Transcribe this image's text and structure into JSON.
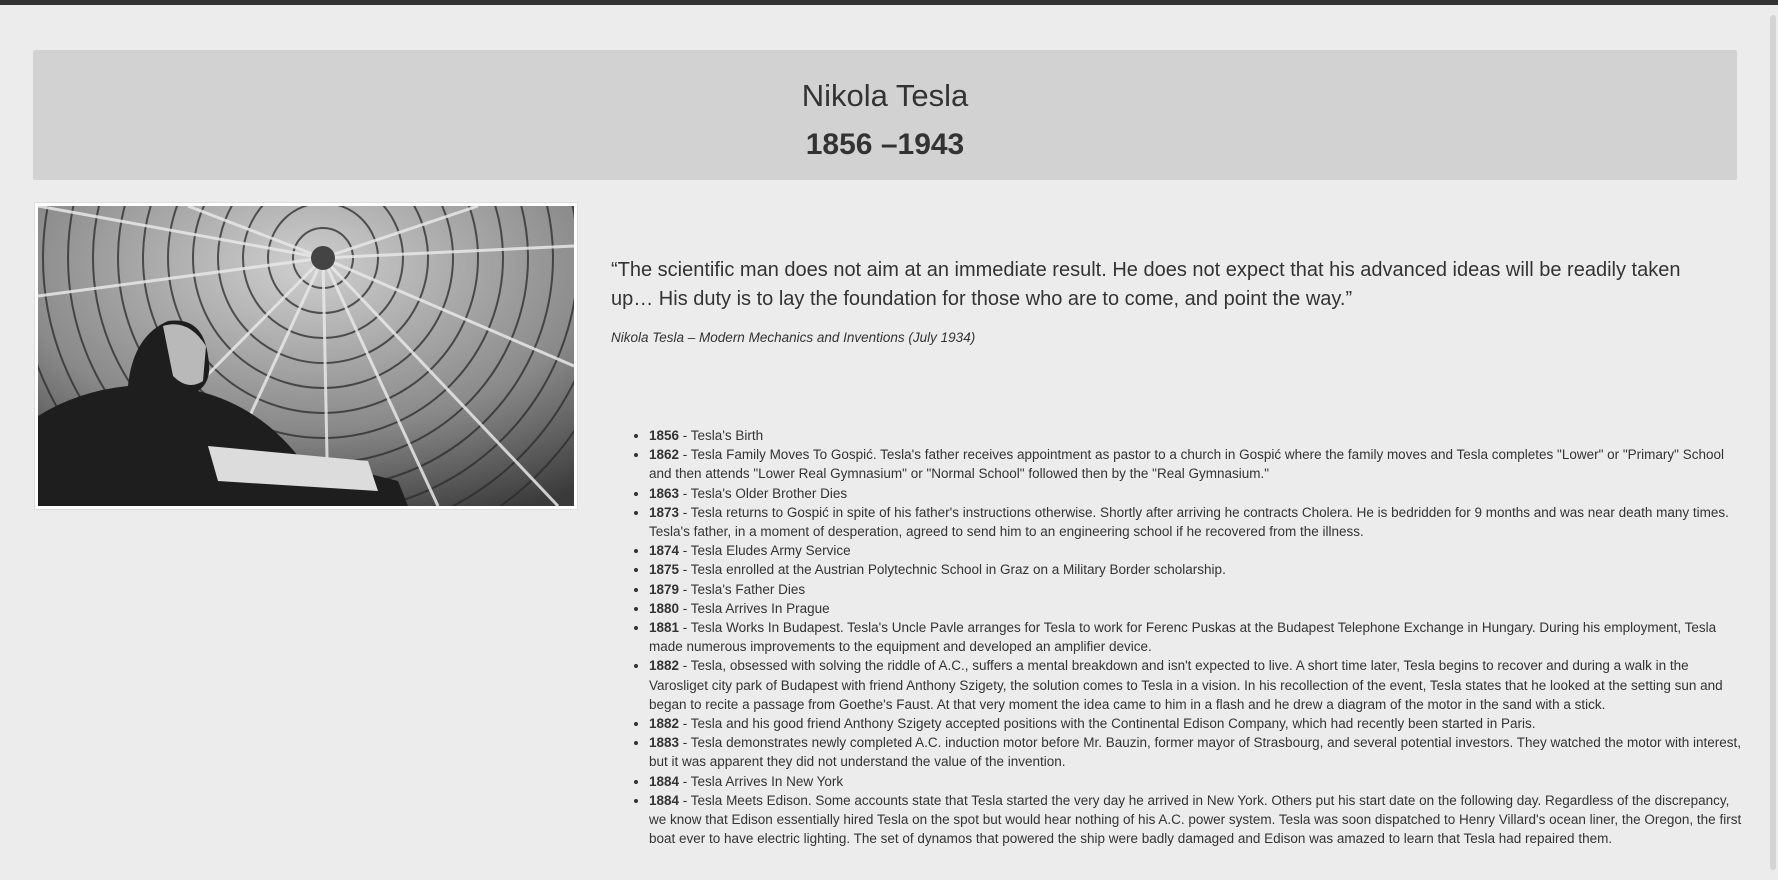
{
  "header": {
    "name": "Nikola Tesla",
    "years": "1856 –1943"
  },
  "photo": {
    "icon": "portrait-photo"
  },
  "quote": {
    "text": "“The scientific man does not aim at an immediate result. He does not expect that his advanced ideas will be readily taken up… His duty is to lay the foundation for those who are to come, and point the way.”",
    "source": "Nikola Tesla – Modern Mechanics and Inventions (July 1934)"
  },
  "timeline": [
    {
      "year": "1856",
      "text": " - Tesla's Birth"
    },
    {
      "year": "1862",
      "text": " - Tesla Family Moves To Gospić. Tesla's father receives appointment as pastor to a church in Gospić where the family moves and Tesla completes \"Lower\" or \"Primary\" School and then attends \"Lower Real Gymnasium\" or \"Normal School\" followed then by the \"Real Gymnasium.\""
    },
    {
      "year": "1863",
      "text": " - Tesla's Older Brother Dies"
    },
    {
      "year": "1873",
      "text": " - Tesla returns to Gospić in spite of his father's instructions otherwise. Shortly after arriving he contracts Cholera. He is bedridden for 9 months and was near death many times. Tesla's father, in a moment of desperation, agreed to send him to an engineering school if he recovered from the illness."
    },
    {
      "year": "1874",
      "text": " - Tesla Eludes Army Service"
    },
    {
      "year": "1875",
      "text": " - Tesla enrolled at the Austrian Polytechnic School in Graz on a Military Border scholarship."
    },
    {
      "year": "1879",
      "text": " - Tesla's Father Dies"
    },
    {
      "year": "1880",
      "text": " - Tesla Arrives In Prague"
    },
    {
      "year": "1881",
      "text": " - Tesla Works In Budapest. Tesla's Uncle Pavle arranges for Tesla to work for Ferenc Puskas at the Budapest Telephone Exchange in Hungary. During his employment, Tesla made numerous improvements to the equipment and developed an amplifier device."
    },
    {
      "year": "1882",
      "text": " - Tesla, obsessed with solving the riddle of A.C., suffers a mental breakdown and isn't expected to live. A short time later, Tesla begins to recover and during a walk in the Varosliget city park of Budapest with friend Anthony Szigety, the solution comes to Tesla in a vision. In his recollection of the event, Tesla states that he looked at the setting sun and began to recite a passage from Goethe's Faust. At that very moment the idea came to him in a flash and he drew a diagram of the motor in the sand with a stick."
    },
    {
      "year": "1882",
      "text": " - Tesla and his good friend Anthony Szigety accepted positions with the Continental Edison Company, which had recently been started in Paris."
    },
    {
      "year": "1883",
      "text": " - Tesla demonstrates newly completed A.C. induction motor before Mr. Bauzin, former mayor of Strasbourg, and several potential investors. They watched the motor with interest, but it was apparent they did not understand the value of the invention."
    },
    {
      "year": "1884",
      "text": " - Tesla Arrives In New York"
    },
    {
      "year": "1884",
      "text": " - Tesla Meets Edison. Some accounts state that Tesla started the very day he arrived in New York. Others put his start date on the following day. Regardless of the discrepancy, we know that Edison essentially hired Tesla on the spot but would hear nothing of his A.C. power system. Tesla was soon dispatched to Henry Villard's ocean liner, the Oregon, the first boat ever to have electric lighting. The set of dynamos that powered the ship were badly damaged and Edison was amazed to learn that Tesla had repaired them."
    }
  ]
}
